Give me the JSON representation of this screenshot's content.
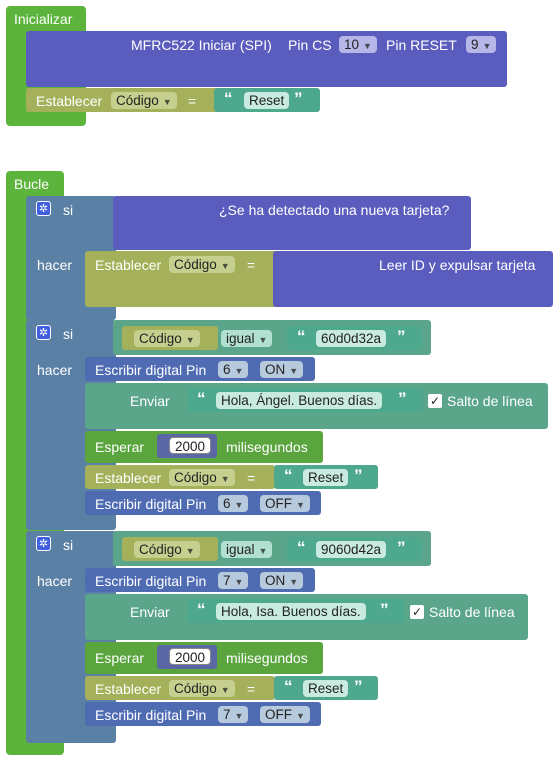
{
  "setup": {
    "title": "Inicializar",
    "rfid_label": "MFRC522 Iniciar (SPI)",
    "pin_cs_label": "Pin CS",
    "pin_cs_value": "10",
    "pin_reset_label": "Pin RESET",
    "pin_reset_value": "9",
    "set_label": "Establecer",
    "var_name": "Código",
    "equals": "=",
    "string_value": "Reset"
  },
  "loop": {
    "title": "Bucle",
    "if1": {
      "si": "si",
      "condition": "¿Se ha detectado una nueva tarjeta?",
      "hacer": "hacer",
      "set_label": "Establecer",
      "var_name": "Código",
      "equals": "=",
      "read_label": "Leer ID y expulsar tarjeta"
    },
    "if2": {
      "si": "si",
      "var_name": "Código",
      "compare": "igual",
      "compare_value": "60d0d32a",
      "hacer": "hacer",
      "write_label": "Escribir digital Pin",
      "pin": "6",
      "state_on": "ON",
      "send_label": "Enviar",
      "message": "Hola, Ángel. Buenos días.",
      "newline_label": "Salto de línea",
      "wait_label": "Esperar",
      "wait_value": "2000",
      "ms_label": "milisegundos",
      "set_label": "Establecer",
      "equals": "=",
      "reset_value": "Reset",
      "state_off": "OFF"
    },
    "if3": {
      "si": "si",
      "var_name": "Código",
      "compare": "igual",
      "compare_value": "9060d42a",
      "hacer": "hacer",
      "write_label": "Escribir digital Pin",
      "pin": "7",
      "state_on": "ON",
      "send_label": "Enviar",
      "message": "Hola, Isa. Buenos días.",
      "newline_label": "Salto de línea",
      "wait_label": "Esperar",
      "wait_value": "2000",
      "ms_label": "milisegundos",
      "set_label": "Establecer",
      "equals": "=",
      "reset_value": "Reset",
      "state_off": "OFF"
    }
  },
  "icons": {
    "gear": "gear-icon",
    "dropdown": "dropdown-arrow-icon",
    "check": "checkmark-icon",
    "quote": "quote-icon"
  },
  "colors": {
    "event": "#5cb43c",
    "rfid": "#5a5dbd",
    "control": "#5b80a5",
    "variable": "#a5b05a",
    "text": "#4ea88e"
  }
}
